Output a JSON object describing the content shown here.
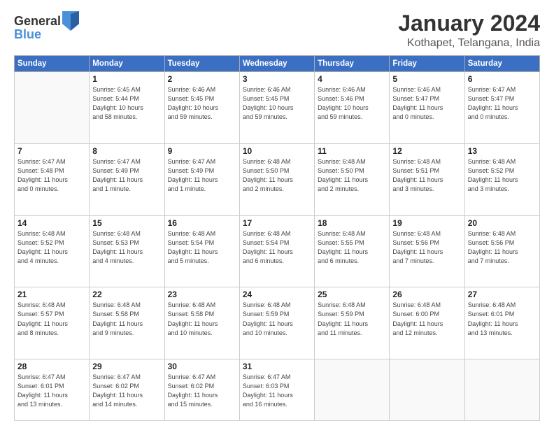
{
  "header": {
    "logo_general": "General",
    "logo_blue": "Blue",
    "title": "January 2024",
    "subtitle": "Kothapet, Telangana, India"
  },
  "calendar": {
    "days_of_week": [
      "Sunday",
      "Monday",
      "Tuesday",
      "Wednesday",
      "Thursday",
      "Friday",
      "Saturday"
    ],
    "weeks": [
      [
        {
          "day": "",
          "info": ""
        },
        {
          "day": "1",
          "info": "Sunrise: 6:45 AM\nSunset: 5:44 PM\nDaylight: 10 hours\nand 58 minutes."
        },
        {
          "day": "2",
          "info": "Sunrise: 6:46 AM\nSunset: 5:45 PM\nDaylight: 10 hours\nand 59 minutes."
        },
        {
          "day": "3",
          "info": "Sunrise: 6:46 AM\nSunset: 5:45 PM\nDaylight: 10 hours\nand 59 minutes."
        },
        {
          "day": "4",
          "info": "Sunrise: 6:46 AM\nSunset: 5:46 PM\nDaylight: 10 hours\nand 59 minutes."
        },
        {
          "day": "5",
          "info": "Sunrise: 6:46 AM\nSunset: 5:47 PM\nDaylight: 11 hours\nand 0 minutes."
        },
        {
          "day": "6",
          "info": "Sunrise: 6:47 AM\nSunset: 5:47 PM\nDaylight: 11 hours\nand 0 minutes."
        }
      ],
      [
        {
          "day": "7",
          "info": "Sunrise: 6:47 AM\nSunset: 5:48 PM\nDaylight: 11 hours\nand 0 minutes."
        },
        {
          "day": "8",
          "info": "Sunrise: 6:47 AM\nSunset: 5:49 PM\nDaylight: 11 hours\nand 1 minute."
        },
        {
          "day": "9",
          "info": "Sunrise: 6:47 AM\nSunset: 5:49 PM\nDaylight: 11 hours\nand 1 minute."
        },
        {
          "day": "10",
          "info": "Sunrise: 6:48 AM\nSunset: 5:50 PM\nDaylight: 11 hours\nand 2 minutes."
        },
        {
          "day": "11",
          "info": "Sunrise: 6:48 AM\nSunset: 5:50 PM\nDaylight: 11 hours\nand 2 minutes."
        },
        {
          "day": "12",
          "info": "Sunrise: 6:48 AM\nSunset: 5:51 PM\nDaylight: 11 hours\nand 3 minutes."
        },
        {
          "day": "13",
          "info": "Sunrise: 6:48 AM\nSunset: 5:52 PM\nDaylight: 11 hours\nand 3 minutes."
        }
      ],
      [
        {
          "day": "14",
          "info": "Sunrise: 6:48 AM\nSunset: 5:52 PM\nDaylight: 11 hours\nand 4 minutes."
        },
        {
          "day": "15",
          "info": "Sunrise: 6:48 AM\nSunset: 5:53 PM\nDaylight: 11 hours\nand 4 minutes."
        },
        {
          "day": "16",
          "info": "Sunrise: 6:48 AM\nSunset: 5:54 PM\nDaylight: 11 hours\nand 5 minutes."
        },
        {
          "day": "17",
          "info": "Sunrise: 6:48 AM\nSunset: 5:54 PM\nDaylight: 11 hours\nand 6 minutes."
        },
        {
          "day": "18",
          "info": "Sunrise: 6:48 AM\nSunset: 5:55 PM\nDaylight: 11 hours\nand 6 minutes."
        },
        {
          "day": "19",
          "info": "Sunrise: 6:48 AM\nSunset: 5:56 PM\nDaylight: 11 hours\nand 7 minutes."
        },
        {
          "day": "20",
          "info": "Sunrise: 6:48 AM\nSunset: 5:56 PM\nDaylight: 11 hours\nand 7 minutes."
        }
      ],
      [
        {
          "day": "21",
          "info": "Sunrise: 6:48 AM\nSunset: 5:57 PM\nDaylight: 11 hours\nand 8 minutes."
        },
        {
          "day": "22",
          "info": "Sunrise: 6:48 AM\nSunset: 5:58 PM\nDaylight: 11 hours\nand 9 minutes."
        },
        {
          "day": "23",
          "info": "Sunrise: 6:48 AM\nSunset: 5:58 PM\nDaylight: 11 hours\nand 10 minutes."
        },
        {
          "day": "24",
          "info": "Sunrise: 6:48 AM\nSunset: 5:59 PM\nDaylight: 11 hours\nand 10 minutes."
        },
        {
          "day": "25",
          "info": "Sunrise: 6:48 AM\nSunset: 5:59 PM\nDaylight: 11 hours\nand 11 minutes."
        },
        {
          "day": "26",
          "info": "Sunrise: 6:48 AM\nSunset: 6:00 PM\nDaylight: 11 hours\nand 12 minutes."
        },
        {
          "day": "27",
          "info": "Sunrise: 6:48 AM\nSunset: 6:01 PM\nDaylight: 11 hours\nand 13 minutes."
        }
      ],
      [
        {
          "day": "28",
          "info": "Sunrise: 6:47 AM\nSunset: 6:01 PM\nDaylight: 11 hours\nand 13 minutes."
        },
        {
          "day": "29",
          "info": "Sunrise: 6:47 AM\nSunset: 6:02 PM\nDaylight: 11 hours\nand 14 minutes."
        },
        {
          "day": "30",
          "info": "Sunrise: 6:47 AM\nSunset: 6:02 PM\nDaylight: 11 hours\nand 15 minutes."
        },
        {
          "day": "31",
          "info": "Sunrise: 6:47 AM\nSunset: 6:03 PM\nDaylight: 11 hours\nand 16 minutes."
        },
        {
          "day": "",
          "info": ""
        },
        {
          "day": "",
          "info": ""
        },
        {
          "day": "",
          "info": ""
        }
      ]
    ]
  }
}
